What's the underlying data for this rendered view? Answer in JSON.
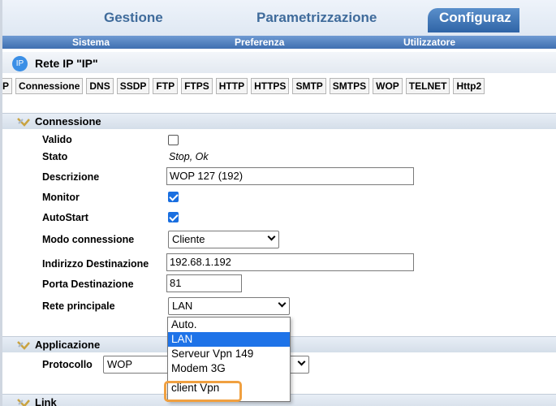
{
  "top_tabs": [
    {
      "label": "Gestione"
    },
    {
      "label": "Parametrizzazione"
    },
    {
      "label": "Configuraz"
    }
  ],
  "sub_tabs": [
    {
      "label": "Sistema"
    },
    {
      "label": "Preferenza"
    },
    {
      "label": "Utilizzatore"
    }
  ],
  "page": {
    "icon_text": "IP",
    "title": "Rete IP \"IP\""
  },
  "protocol_tabs": [
    "P",
    "Connessione",
    "DNS",
    "SSDP",
    "FTP",
    "FTPS",
    "HTTP",
    "HTTPS",
    "SMTP",
    "SMTPS",
    "WOP",
    "TELNET",
    "Http2"
  ],
  "connessione": {
    "title": "Connessione",
    "valido_label": "Valido",
    "valido_checked": false,
    "stato_label": "Stato",
    "stato_value": "Stop, Ok",
    "descrizione_label": "Descrizione",
    "descrizione_value": "WOP 127 (192)",
    "monitor_label": "Monitor",
    "monitor_checked": true,
    "autostart_label": "AutoStart",
    "autostart_checked": true,
    "modo_label": "Modo connessione",
    "modo_value": "Cliente",
    "indirizzo_label": "Indirizzo Destinazione",
    "indirizzo_value": "192.68.1.192",
    "porta_label": "Porta Destinazione",
    "porta_value": "81",
    "rete_label": "Rete principale",
    "rete_value": "LAN"
  },
  "dropdown_options": [
    "Auto.",
    "LAN",
    "Serveur Vpn 149",
    "Modem 3G",
    "client Vpn"
  ],
  "applicazione": {
    "title": "Applicazione",
    "protocollo_label": "Protocollo",
    "protocollo_value": "WOP"
  },
  "link": {
    "title": "Link"
  }
}
